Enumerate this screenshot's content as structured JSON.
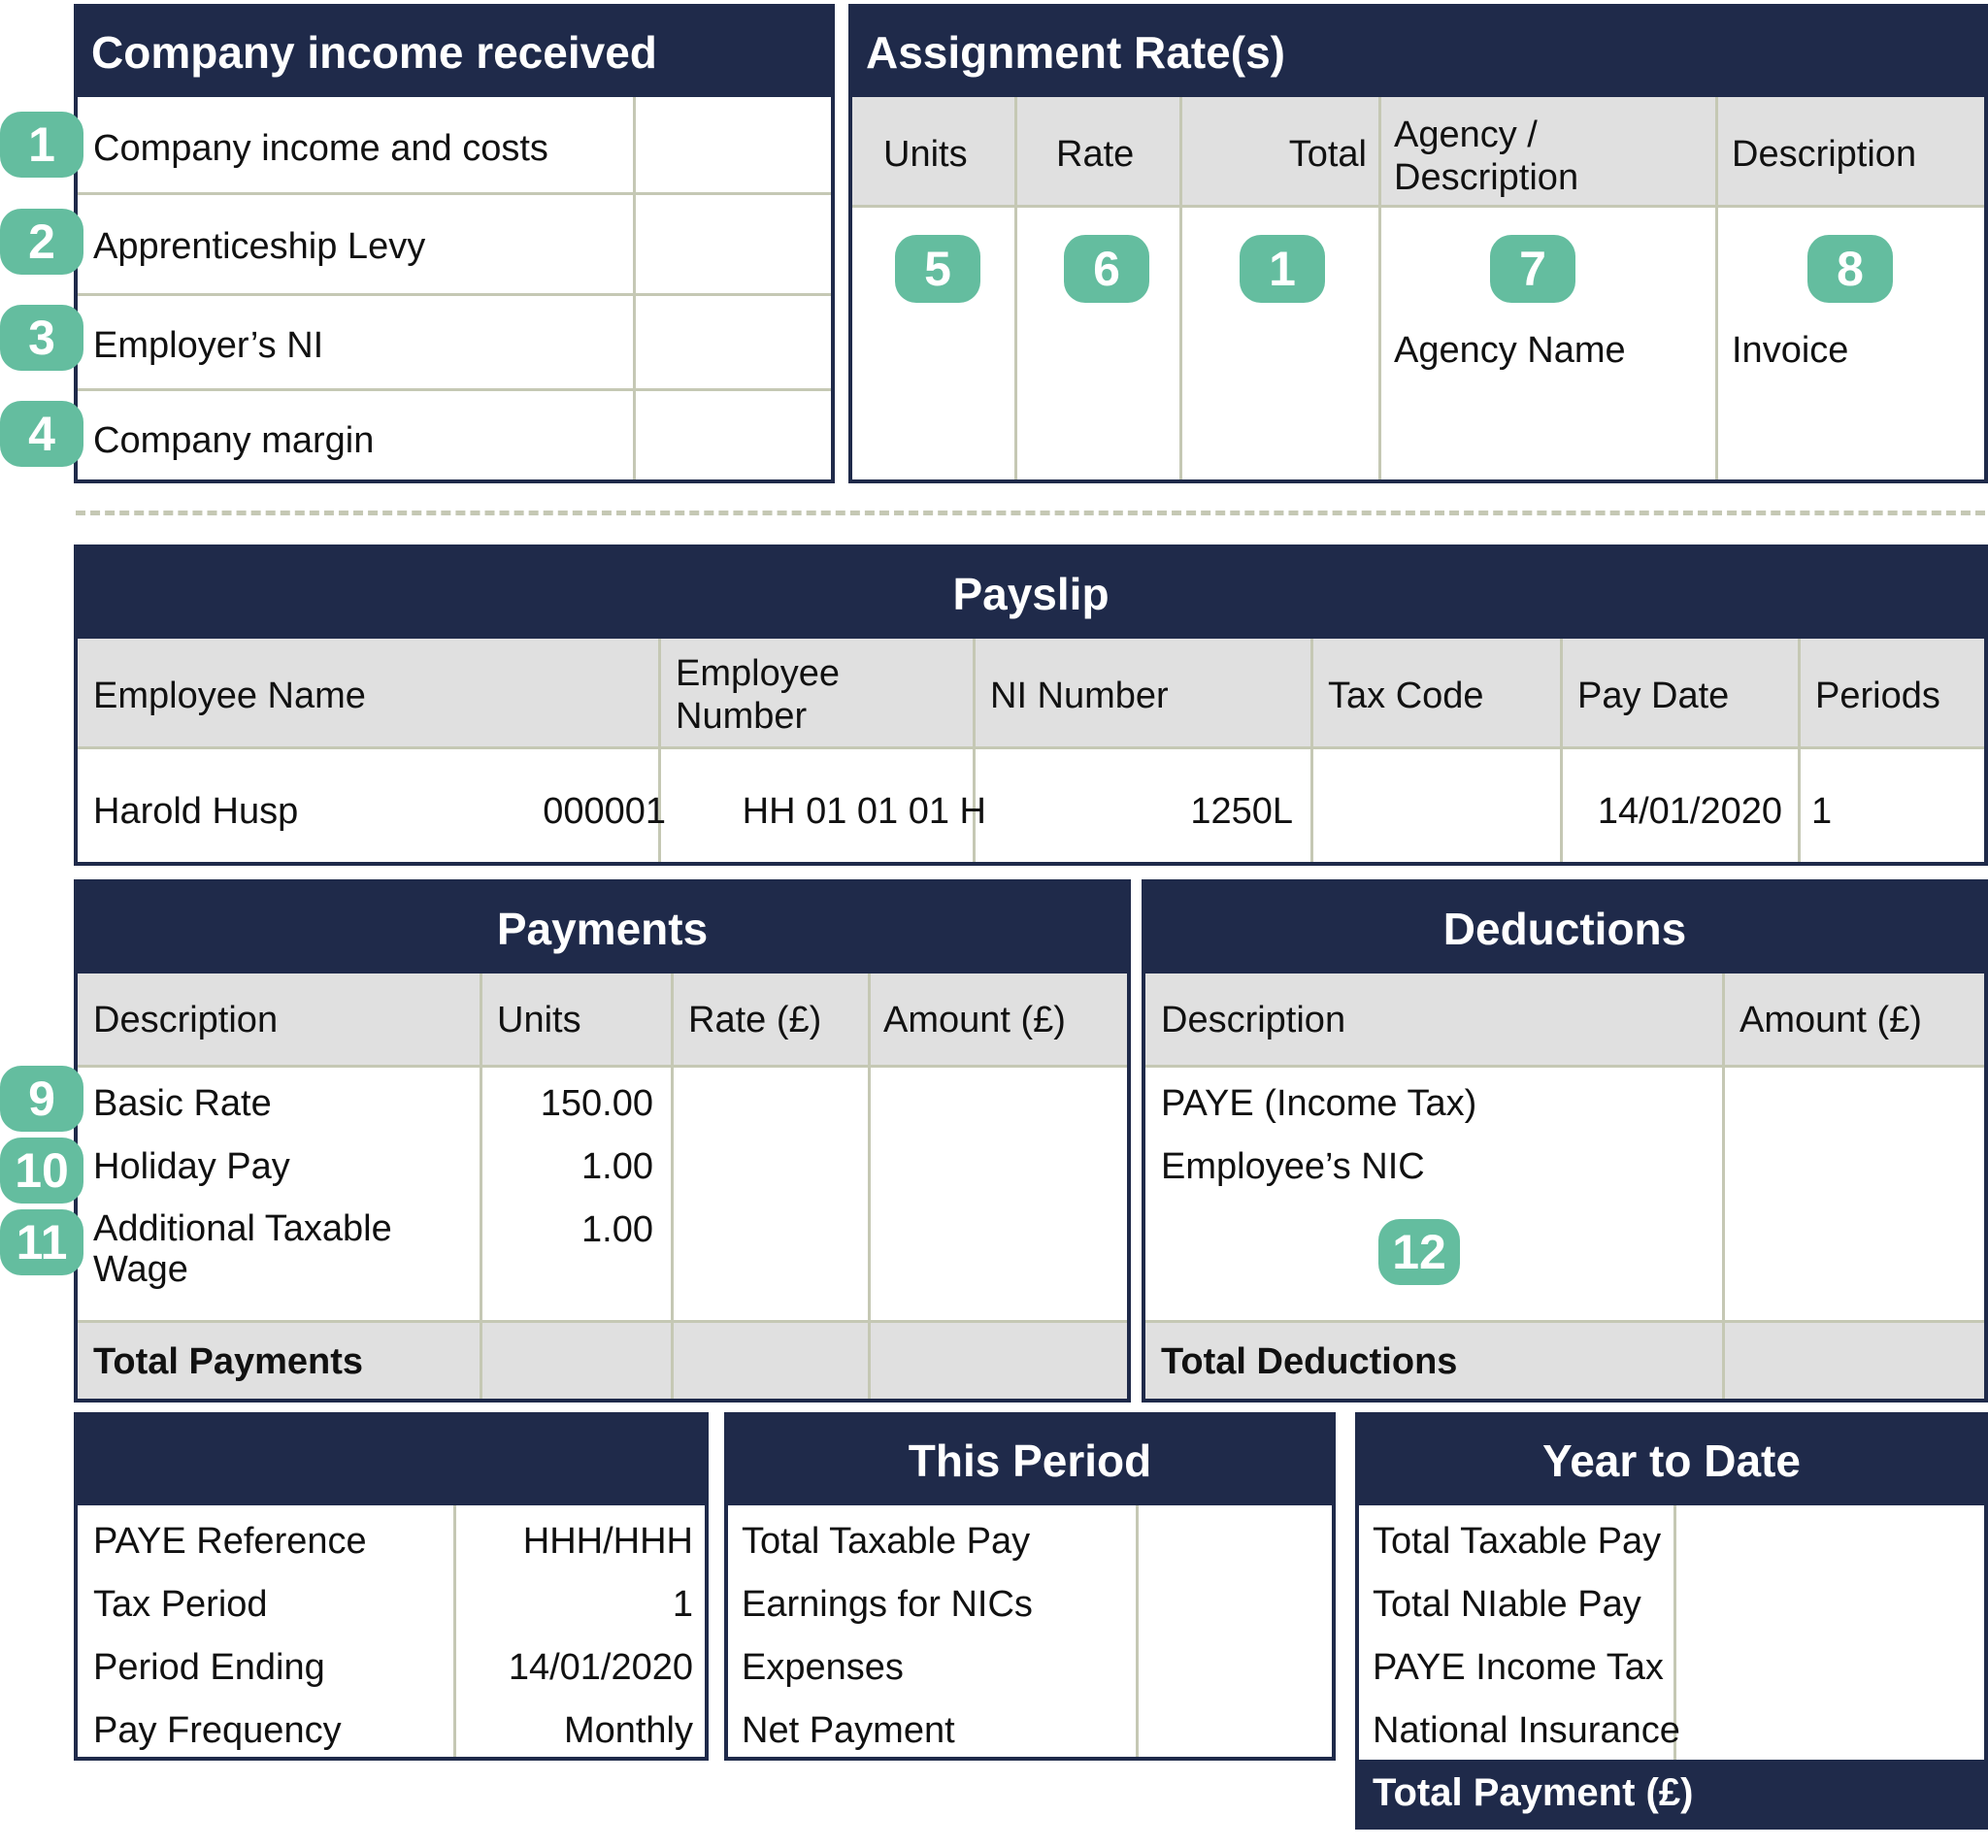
{
  "colors": {
    "navy": "#1f2a4a",
    "badge_green": "#64bd9f",
    "header_gray": "#e0e0e0",
    "grid_line": "#c5c8b4"
  },
  "company_income": {
    "title": "Company income received",
    "rows": [
      {
        "badge": "1",
        "label": "Company income and costs",
        "value": ""
      },
      {
        "badge": "2",
        "label": "Apprenticeship Levy",
        "value": ""
      },
      {
        "badge": "3",
        "label": "Employer’s NI",
        "value": ""
      },
      {
        "badge": "4",
        "label": "Company margin",
        "value": ""
      }
    ]
  },
  "assignment_rates": {
    "title": "Assignment Rate(s)",
    "columns": [
      "Units",
      "Rate",
      "Total",
      "Agency / Description",
      "Description"
    ],
    "badges": [
      "5",
      "6",
      "1",
      "7",
      "8"
    ],
    "values": {
      "agency": "Agency Name",
      "description": "Invoice"
    }
  },
  "payslip": {
    "title": "Payslip",
    "columns": [
      "Employee Name",
      "Employee Number",
      "NI Number",
      "Tax Code",
      "Pay Date",
      "Periods"
    ],
    "row": {
      "employee_name": "Harold Husp",
      "employee_number": "000001",
      "ni_number": "HH 01 01 01 H",
      "tax_code": "1250L",
      "pay_date": "14/01/2020",
      "periods": "1"
    }
  },
  "payments": {
    "title": "Payments",
    "columns": [
      "Description",
      "Units",
      "Rate (£)",
      "Amount (£)"
    ],
    "rows": [
      {
        "badge": "9",
        "description": "Basic Rate",
        "units": "150.00",
        "rate": "",
        "amount": ""
      },
      {
        "badge": "10",
        "description": "Holiday Pay",
        "units": "1.00",
        "rate": "",
        "amount": ""
      },
      {
        "badge": "11",
        "description": "Additional Taxable Wage",
        "units": "1.00",
        "rate": "",
        "amount": ""
      }
    ],
    "total_label": "Total Payments"
  },
  "deductions": {
    "title": "Deductions",
    "columns": [
      "Description",
      "Amount (£)"
    ],
    "rows": [
      {
        "description": "PAYE (Income Tax)",
        "amount": ""
      },
      {
        "description": "Employee’s NIC",
        "amount": ""
      }
    ],
    "badge": "12",
    "total_label": "Total Deductions"
  },
  "employer_info": {
    "title": "",
    "rows": [
      {
        "label": "PAYE Reference",
        "value": "HHH/HHH"
      },
      {
        "label": "Tax Period",
        "value": "1"
      },
      {
        "label": "Period Ending",
        "value": "14/01/2020"
      },
      {
        "label": "Pay Frequency",
        "value": "Monthly"
      }
    ]
  },
  "this_period": {
    "title": "This Period",
    "rows": [
      {
        "label": "Total Taxable Pay",
        "value": ""
      },
      {
        "label": "Earnings for NICs",
        "value": ""
      },
      {
        "label": "Expenses",
        "value": ""
      },
      {
        "label": "Net Payment",
        "value": ""
      }
    ]
  },
  "year_to_date": {
    "title": "Year to Date",
    "rows": [
      {
        "label": "Total Taxable Pay",
        "value": ""
      },
      {
        "label": "Total NIable Pay",
        "value": ""
      },
      {
        "label": "PAYE Income Tax",
        "value": ""
      },
      {
        "label": "National Insurance",
        "value": ""
      }
    ],
    "total_label": "Total Payment (£)"
  }
}
